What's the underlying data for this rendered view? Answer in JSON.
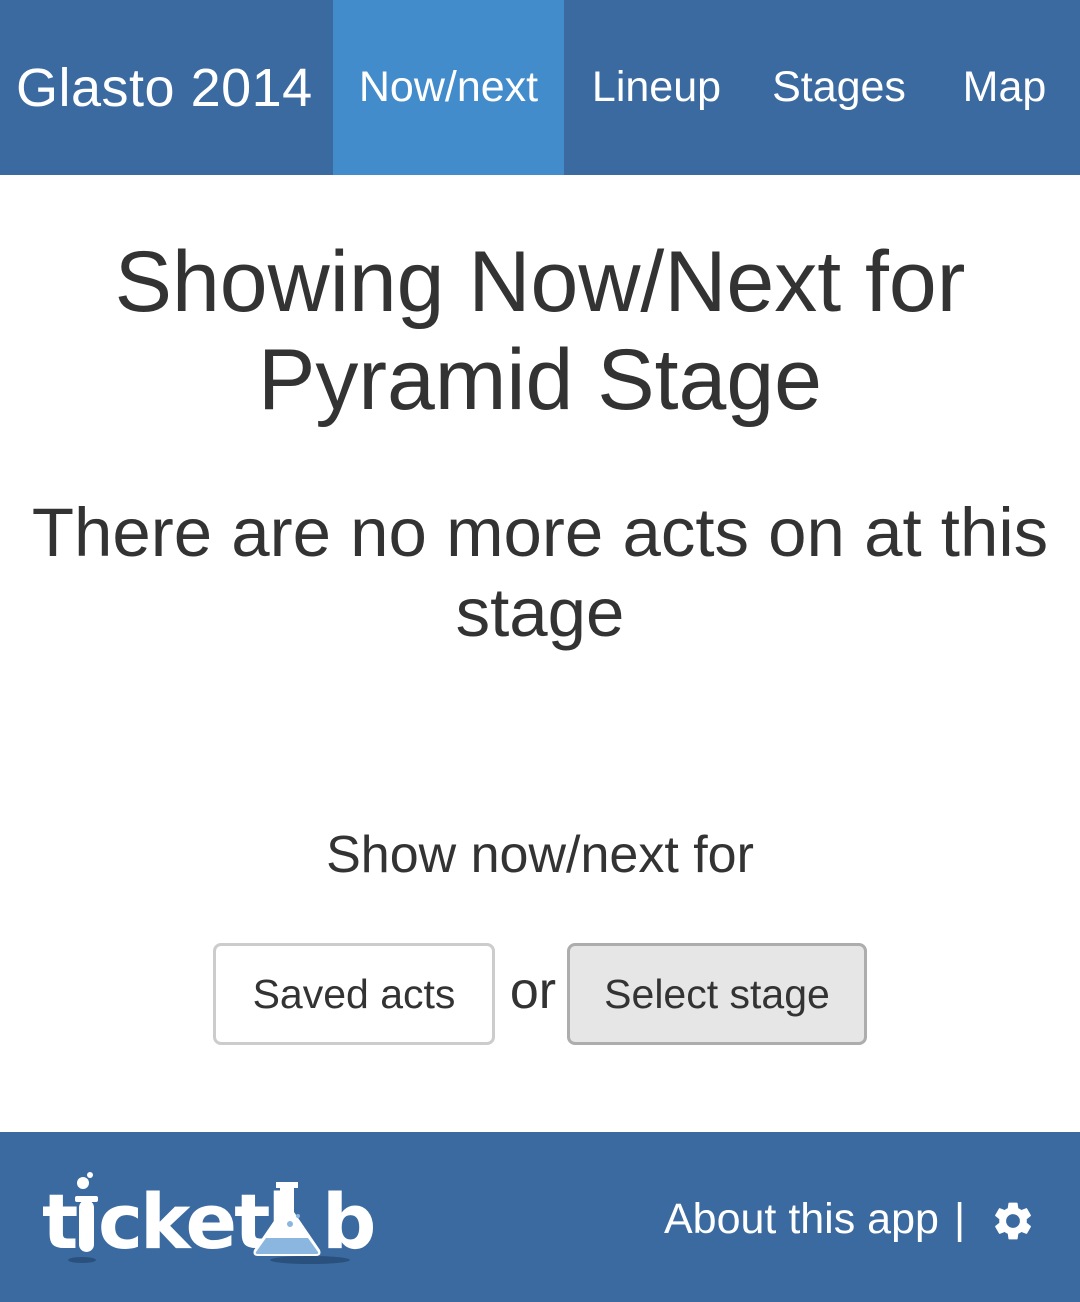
{
  "navbar": {
    "brand": "Glasto 2014",
    "tabs": [
      {
        "label": "Now/next",
        "active": true
      },
      {
        "label": "Lineup",
        "active": false
      },
      {
        "label": "Stages",
        "active": false
      },
      {
        "label": "Map",
        "active": false
      }
    ]
  },
  "main": {
    "title": "Showing Now/Next for Pyramid Stage",
    "message": "There are no more acts on at this stage",
    "prompt": "Show now/next for",
    "saved_acts_label": "Saved acts",
    "or_label": "or",
    "select_stage_label": "Select stage"
  },
  "footer": {
    "logo_text": "ticketlab",
    "about_label": "About this app",
    "separator": "|",
    "settings_icon": "gear-icon"
  },
  "colors": {
    "navbar_bg": "#3a6aa0",
    "active_tab_bg": "#438ccb",
    "text": "#333333",
    "button_pressed_bg": "#e6e6e6"
  }
}
